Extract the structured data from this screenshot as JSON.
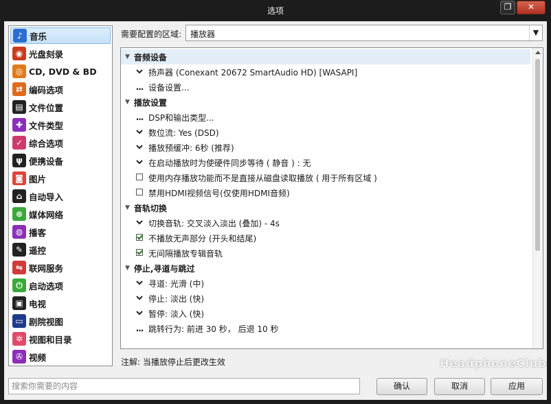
{
  "window": {
    "title": "选项",
    "maximize_glyph": "❐",
    "close_glyph": "✕"
  },
  "sidebar": {
    "items": [
      {
        "label": "音乐",
        "icon": "music-note-icon",
        "glyph": "♪",
        "color": "#2a6fcf",
        "selected": true
      },
      {
        "label": "光盘刻录",
        "icon": "disc-burn-icon",
        "glyph": "◉",
        "color": "#cc3a1e"
      },
      {
        "label": "CD, DVD & BD",
        "icon": "cd-icon",
        "glyph": "◎",
        "color": "#e07a1a"
      },
      {
        "label": "编码选项",
        "icon": "encode-arrows-icon",
        "glyph": "⇄",
        "color": "#e06a1a"
      },
      {
        "label": "文件位置",
        "icon": "file-location-icon",
        "glyph": "▤",
        "color": "#222222"
      },
      {
        "label": "文件类型",
        "icon": "puzzle-icon",
        "glyph": "✚",
        "color": "#8b2fb8"
      },
      {
        "label": "综合选项",
        "icon": "checkbox-icon",
        "glyph": "✓",
        "color": "#d03a6a"
      },
      {
        "label": "便携设备",
        "icon": "usb-icon",
        "glyph": "ψ",
        "color": "#222222"
      },
      {
        "label": "图片",
        "icon": "camera-icon",
        "glyph": "◙",
        "color": "#e0443a"
      },
      {
        "label": "自动导入",
        "icon": "auto-import-icon",
        "glyph": "⌂",
        "color": "#222222"
      },
      {
        "label": "媒体网络",
        "icon": "media-network-icon",
        "glyph": "⊛",
        "color": "#3aa83a"
      },
      {
        "label": "播客",
        "icon": "podcast-icon",
        "glyph": "◍",
        "color": "#8b2fb8"
      },
      {
        "label": "遥控",
        "icon": "remote-control-icon",
        "glyph": "✎",
        "color": "#222222"
      },
      {
        "label": "联网服务",
        "icon": "network-service-icon",
        "glyph": "⇋",
        "color": "#d03a3a"
      },
      {
        "label": "启动选项",
        "icon": "power-icon",
        "glyph": "⏻",
        "color": "#3aa83a"
      },
      {
        "label": "电视",
        "icon": "tv-icon",
        "glyph": "▣",
        "color": "#222222"
      },
      {
        "label": "剧院视图",
        "icon": "theater-view-icon",
        "glyph": "▭",
        "color": "#1e3a8a"
      },
      {
        "label": "视图和目录",
        "icon": "gear-icon",
        "glyph": "✲",
        "color": "#e04a6a"
      },
      {
        "label": "视频",
        "icon": "film-icon",
        "glyph": "✇",
        "color": "#8b2fb8"
      }
    ]
  },
  "region": {
    "label": "需要配置的区域:",
    "value": "播放器",
    "arrow_glyph": "▼"
  },
  "settings": {
    "rows": [
      {
        "kind": "section",
        "label": "音频设备",
        "first": true
      },
      {
        "kind": "dropdown",
        "label": "扬声器 (Conexant 20672 SmartAudio HD) [WASAPI]"
      },
      {
        "kind": "dots",
        "label": "设备设置..."
      },
      {
        "kind": "section",
        "label": "播放设置"
      },
      {
        "kind": "dots",
        "label": "DSP和输出类型..."
      },
      {
        "kind": "dropdown",
        "label": "数位流: Yes (DSD)"
      },
      {
        "kind": "dropdown",
        "label": "播放预缓冲: 6秒 (推荐)"
      },
      {
        "kind": "dropdown",
        "label": "在启动播放时为使硬件同步等待 ( 静音 ) : 无"
      },
      {
        "kind": "checkbox",
        "checked": false,
        "label": "使用内存播放功能而不是直接从磁盘读取播放 ( 用于所有区域 )"
      },
      {
        "kind": "checkbox",
        "checked": false,
        "label": "禁用HDMI视频信号(仅使用HDMI音频)"
      },
      {
        "kind": "section",
        "label": "音轨切换"
      },
      {
        "kind": "dropdown",
        "label": "切换音轨: 交叉淡入淡出 (叠加) - 4s"
      },
      {
        "kind": "checkbox",
        "checked": true,
        "label": "不播放无声部分 (开头和结尾)"
      },
      {
        "kind": "checkbox",
        "checked": true,
        "label": "无间隔播放专辑音轨"
      },
      {
        "kind": "section",
        "label": "停止,寻道与跳过"
      },
      {
        "kind": "dropdown",
        "label": "寻道: 光滑 (中)"
      },
      {
        "kind": "dropdown",
        "label": "停止: 淡出 (快)"
      },
      {
        "kind": "dropdown",
        "label": "暂停: 淡入 (快)"
      },
      {
        "kind": "dots",
        "label": "跳转行为: 前进 30 秒， 后退 10 秒"
      }
    ]
  },
  "note": "注解: 当播放停止后更改生效",
  "search": {
    "placeholder": "搜索你需要的内容"
  },
  "buttons": {
    "ok": "确认",
    "cancel": "取消",
    "apply": "应用"
  },
  "watermark": "HeadphoneClub"
}
